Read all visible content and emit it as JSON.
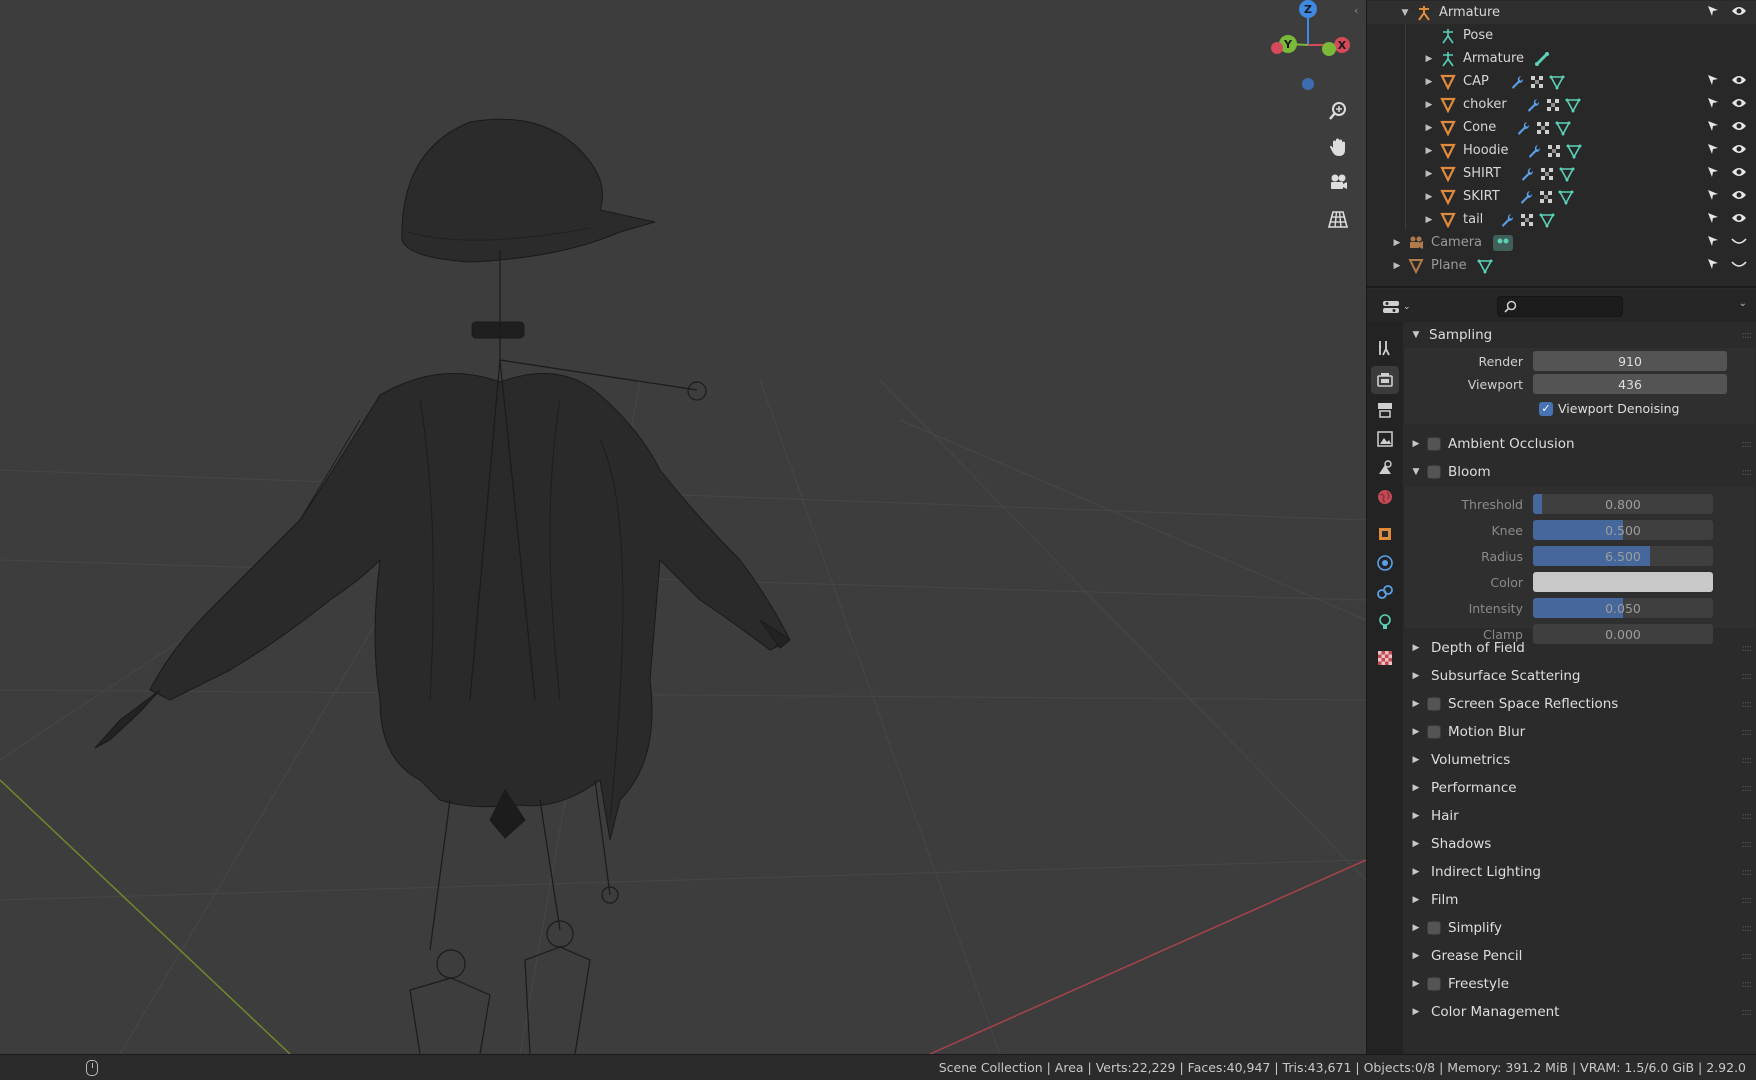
{
  "viewport": {
    "gizmo": {
      "z_label": "Z",
      "y_label": "Y",
      "x_label": "X"
    },
    "tools": [
      {
        "name": "zoom",
        "icon": "zoom-icon"
      },
      {
        "name": "pan",
        "icon": "hand-icon"
      },
      {
        "name": "camera",
        "icon": "camera-icon"
      },
      {
        "name": "grid",
        "icon": "grid-icon"
      }
    ]
  },
  "outliner": {
    "items": [
      {
        "label": "Armature",
        "type": "armature",
        "expanded": true
      },
      {
        "label": "Pose",
        "type": "pose"
      },
      {
        "label": "Armature",
        "type": "armature-data"
      },
      {
        "label": "CAP",
        "type": "mesh"
      },
      {
        "label": "choker",
        "type": "mesh"
      },
      {
        "label": "Cone",
        "type": "mesh"
      },
      {
        "label": "Hoodie",
        "type": "mesh"
      },
      {
        "label": "SHIRT",
        "type": "mesh"
      },
      {
        "label": "SKIRT",
        "type": "mesh"
      },
      {
        "label": "tail",
        "type": "mesh"
      },
      {
        "label": "Camera",
        "type": "camera",
        "hidden": true
      },
      {
        "label": "Plane",
        "type": "mesh",
        "hidden": true
      }
    ]
  },
  "properties": {
    "search_placeholder": "",
    "sampling": {
      "title": "Sampling",
      "render_label": "Render",
      "render_value": "910",
      "viewport_label": "Viewport",
      "viewport_value": "436",
      "denoise_label": "Viewport Denoising",
      "denoise_checked": true
    },
    "ambient_occlusion": "Ambient Occlusion",
    "bloom": {
      "title": "Bloom",
      "threshold_label": "Threshold",
      "threshold_value": "0.800",
      "threshold_fill": 0.05,
      "knee_label": "Knee",
      "knee_value": "0.500",
      "knee_fill": 0.5,
      "radius_label": "Radius",
      "radius_value": "6.500",
      "radius_fill": 0.65,
      "color_label": "Color",
      "color_value": "#c8c8c8",
      "intensity_label": "Intensity",
      "intensity_value": "0.050",
      "intensity_fill": 0.5,
      "clamp_label": "Clamp",
      "clamp_value": "0.000"
    },
    "panels": [
      {
        "label": "Depth of Field",
        "checkbox": false
      },
      {
        "label": "Subsurface Scattering",
        "checkbox": false
      },
      {
        "label": "Screen Space Reflections",
        "checkbox": true
      },
      {
        "label": "Motion Blur",
        "checkbox": true
      },
      {
        "label": "Volumetrics",
        "checkbox": false
      },
      {
        "label": "Performance",
        "checkbox": false
      },
      {
        "label": "Hair",
        "checkbox": false
      },
      {
        "label": "Shadows",
        "checkbox": false
      },
      {
        "label": "Indirect Lighting",
        "checkbox": false
      },
      {
        "label": "Film",
        "checkbox": false
      },
      {
        "label": "Simplify",
        "checkbox": true
      },
      {
        "label": "Grease Pencil",
        "checkbox": false
      },
      {
        "label": "Freestyle",
        "checkbox": true
      },
      {
        "label": "Color Management",
        "checkbox": false
      }
    ]
  },
  "statusbar": {
    "stats": "Scene Collection | Area | Verts:22,229 | Faces:40,947 | Tris:43,671 | Objects:0/8 | Memory: 391.2 MiB | VRAM: 1.5/6.0 GiB | 2.92.0"
  },
  "colors": {
    "viewport_bg": "#3d3d3d",
    "accent": "#4772b3",
    "mesh_icon": "#e08a3c",
    "data_icon": "#5bd1b8",
    "axis_x": "#d44a5a",
    "axis_y": "#7ab83a",
    "axis_z": "#3d8ae0"
  }
}
